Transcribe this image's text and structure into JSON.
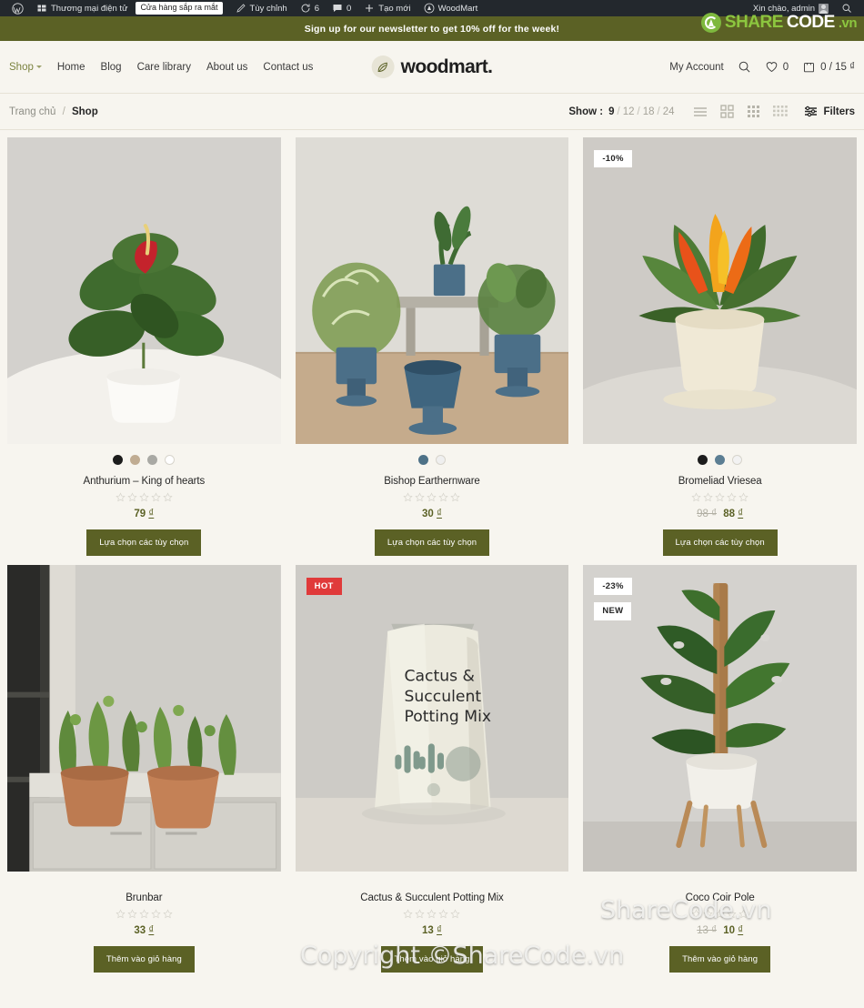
{
  "adminbar": {
    "items": [
      {
        "name": "wordpress-logo",
        "icon": "wordpress-icon",
        "label": ""
      },
      {
        "name": "site-name",
        "icon": "dashboard-icon",
        "label": "Thương mại điện tử"
      },
      {
        "name": "coming-soon-pill",
        "icon": "",
        "label": "Cửa hàng sắp ra mắt"
      },
      {
        "name": "customize",
        "icon": "pencil-icon",
        "label": "Tùy chỉnh"
      },
      {
        "name": "updates",
        "icon": "update-icon",
        "label": "6"
      },
      {
        "name": "comments",
        "icon": "comment-icon",
        "label": "0"
      },
      {
        "name": "new-content",
        "icon": "plus-icon",
        "label": "Tạo mới"
      },
      {
        "name": "woodmart-theme",
        "icon": "woodmart-icon",
        "label": "WoodMart"
      }
    ],
    "greeting": "Xin chào, admin",
    "search_icon": "search-icon"
  },
  "watermark": {
    "logo_share": "SHARE",
    "logo_code": "CODE",
    "logo_vn": ".vn",
    "copyright": "Copyright ©ShareCode.vn",
    "sharecode": "ShareCode.vn"
  },
  "notice": {
    "text": "Sign up for our newsletter to get 10% off for the week!",
    "bg": "#5b6125"
  },
  "header": {
    "nav": [
      {
        "label": "Shop",
        "active": true,
        "has_caret": true
      },
      {
        "label": "Home",
        "active": false,
        "has_caret": false
      },
      {
        "label": "Blog",
        "active": false,
        "has_caret": false
      },
      {
        "label": "Care library",
        "active": false,
        "has_caret": false
      },
      {
        "label": "About us",
        "active": false,
        "has_caret": false
      },
      {
        "label": "Contact us",
        "active": false,
        "has_caret": false
      }
    ],
    "brand": "woodmart.",
    "account_label": "My Account",
    "search_icon": "search-icon",
    "wishlist_icon": "heart-icon",
    "wishlist_count": "0",
    "cart_icon": "cart-icon",
    "cart_summary": "0 / 15 ₫"
  },
  "toolbar": {
    "breadcrumb_home": "Trang chủ",
    "breadcrumb_sep": "/",
    "breadcrumb_current": "Shop",
    "show_label": "Show :",
    "show_options": [
      "9",
      "12",
      "18",
      "24"
    ],
    "show_active": "9",
    "view_icons": [
      "list-view-icon",
      "grid-2-icon",
      "grid-3-icon",
      "grid-4-icon"
    ],
    "filters_icon": "filters-icon",
    "filters_label": "Filters"
  },
  "products": [
    {
      "name": "Anthurium – King of hearts",
      "badges": [],
      "swatches": [
        "#1c1c1c",
        "#c0ac92",
        "#a9a9a4",
        "#ffffff"
      ],
      "rating": 0,
      "price_old": "",
      "price": "79",
      "currency": "₫",
      "button": "Lựa chọn các tùy chọn",
      "image": "anthurium-red-flower-white-pot"
    },
    {
      "name": "Bishop Earthernware",
      "badges": [],
      "swatches": [
        "#4d7187",
        "#efefef"
      ],
      "rating": 0,
      "price_old": "",
      "price": "30",
      "currency": "₫",
      "button": "Lựa chọn các tùy chọn",
      "image": "blue-ceramic-planters-group"
    },
    {
      "name": "Bromeliad Vriesea",
      "badges": [
        {
          "text": "-10%",
          "type": "discount"
        }
      ],
      "swatches": [
        "#1c1c1c",
        "#5c7e93",
        "#f2f2f2"
      ],
      "rating": 0,
      "price_old": "98 ₫",
      "price": "88",
      "currency": "₫",
      "button": "Lựa chọn các tùy chọn",
      "image": "bromeliad-orange-flower-cream-pot"
    },
    {
      "name": "Brunbar",
      "badges": [],
      "swatches": [],
      "rating": 0,
      "price_old": "",
      "price": "33",
      "currency": "₫",
      "button": "Thêm vào giỏ hàng",
      "image": "terracotta-pots-balcony-ledge"
    },
    {
      "name": "Cactus & Succulent Potting Mix",
      "badges": [
        {
          "text": "HOT",
          "type": "hot"
        }
      ],
      "swatches": [],
      "rating": 0,
      "price_old": "",
      "price": "13",
      "currency": "₫",
      "button": "Thêm vào giỏ hàng",
      "image": "potting-mix-bag"
    },
    {
      "name": "Coco Coir Pole",
      "badges": [
        {
          "text": "-23%",
          "type": "discount"
        },
        {
          "text": "NEW",
          "type": "new"
        }
      ],
      "swatches": [],
      "rating": 0,
      "price_old": "13 ₫",
      "price": "10",
      "currency": "₫",
      "button": "Thêm vào giỏ hàng",
      "image": "monstera-on-coir-pole-stand"
    }
  ]
}
